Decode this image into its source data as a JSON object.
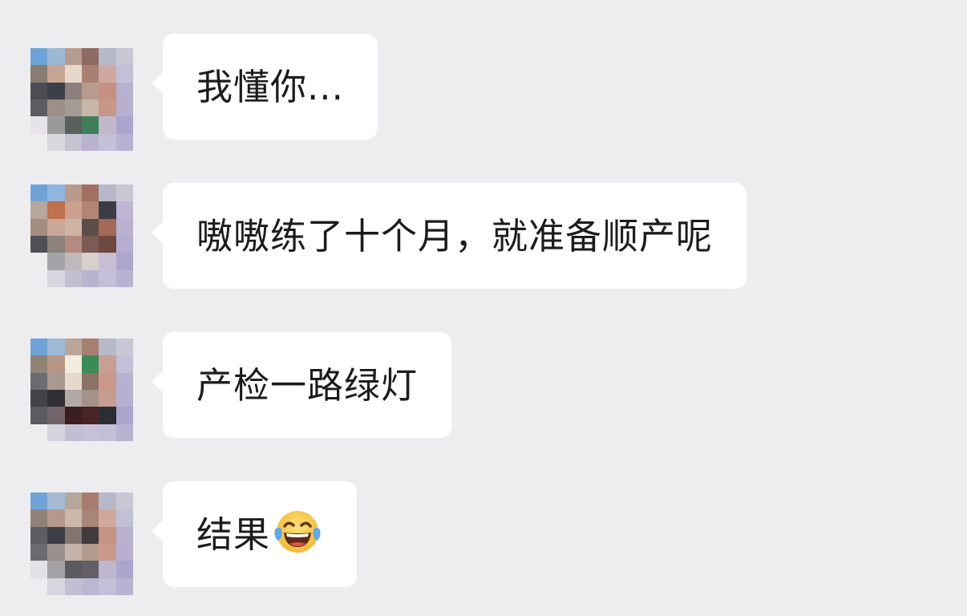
{
  "messages": [
    {
      "text": "我懂你...",
      "emoji": null,
      "avatar": "pixelated-avatar"
    },
    {
      "text": "嗷嗷练了十个月，就准备顺产呢",
      "emoji": null,
      "avatar": "pixelated-avatar"
    },
    {
      "text": "产检一路绿灯",
      "emoji": null,
      "avatar": "pixelated-avatar"
    },
    {
      "text": "结果",
      "emoji": "tears-of-joy-icon",
      "avatar": "pixelated-avatar"
    }
  ],
  "colors": {
    "background": "#ededef",
    "bubble": "#ffffff",
    "text": "#1c1c1e",
    "emoji_face": "#f7c843"
  }
}
